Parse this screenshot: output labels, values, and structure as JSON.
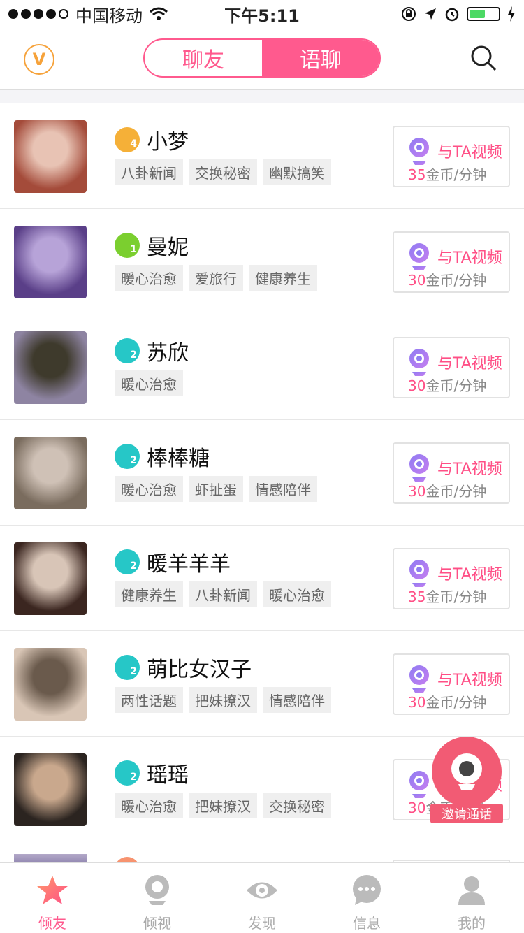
{
  "status_bar": {
    "carrier": "中国移动",
    "time": "下午5:11"
  },
  "header": {
    "vip_label": "V",
    "tabs": [
      "聊友",
      "语聊"
    ],
    "active_tab": 1
  },
  "users": [
    {
      "name": "小梦",
      "level": "4",
      "level_color": "#f5b038",
      "tags": [
        "八卦新闻",
        "交换秘密",
        "幽默搞笑"
      ],
      "call_label": "与TA视频",
      "price": "35",
      "price_unit": "金币/分钟"
    },
    {
      "name": "曼妮",
      "level": "1",
      "level_color": "#7bcf2f",
      "tags": [
        "暖心治愈",
        "爱旅行",
        "健康养生"
      ],
      "call_label": "与TA视频",
      "price": "30",
      "price_unit": "金币/分钟"
    },
    {
      "name": "苏欣",
      "level": "2",
      "level_color": "#26c7c7",
      "tags": [
        "暖心治愈"
      ],
      "call_label": "与TA视频",
      "price": "30",
      "price_unit": "金币/分钟"
    },
    {
      "name": "棒棒糖",
      "level": "2",
      "level_color": "#26c7c7",
      "tags": [
        "暖心治愈",
        "虾扯蛋",
        "情感陪伴"
      ],
      "call_label": "与TA视频",
      "price": "30",
      "price_unit": "金币/分钟"
    },
    {
      "name": "暖羊羊羊",
      "level": "2",
      "level_color": "#26c7c7",
      "tags": [
        "健康养生",
        "八卦新闻",
        "暖心治愈"
      ],
      "call_label": "与TA视频",
      "price": "35",
      "price_unit": "金币/分钟"
    },
    {
      "name": "萌比女汉子",
      "level": "2",
      "level_color": "#26c7c7",
      "tags": [
        "两性话题",
        "把妹撩汉",
        "情感陪伴"
      ],
      "call_label": "与TA视频",
      "price": "30",
      "price_unit": "金币/分钟"
    },
    {
      "name": "瑶瑶",
      "level": "2",
      "level_color": "#26c7c7",
      "tags": [
        "暖心治愈",
        "把妹撩汉",
        "交换秘密"
      ],
      "call_label": "与TA视频",
      "price": "30",
      "price_unit": "金币/分钟"
    }
  ],
  "invite_label": "邀请通话",
  "tabbar": [
    {
      "label": "倾友",
      "icon": "star-icon"
    },
    {
      "label": "倾视",
      "icon": "webcam-icon"
    },
    {
      "label": "发现",
      "icon": "eye-icon"
    },
    {
      "label": "信息",
      "icon": "chat-bubble-icon"
    },
    {
      "label": "我的",
      "icon": "person-icon"
    }
  ],
  "colors": {
    "accent": "#ff5a8e",
    "vip": "#f6a23a",
    "price": "#ff4f86",
    "invite": "#f25b74"
  }
}
